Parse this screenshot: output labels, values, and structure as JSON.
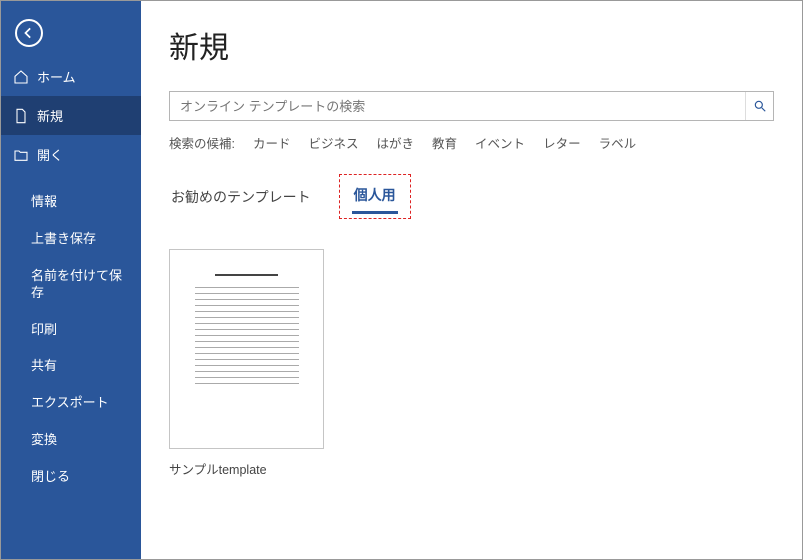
{
  "page": {
    "title": "新規"
  },
  "sidebar": {
    "top": [
      {
        "label": "ホーム",
        "icon": "home"
      },
      {
        "label": "新規",
        "icon": "doc"
      },
      {
        "label": "開く",
        "icon": "folder"
      }
    ],
    "sub": [
      {
        "label": "情報"
      },
      {
        "label": "上書き保存"
      },
      {
        "label": "名前を付けて保存"
      },
      {
        "label": "印刷"
      },
      {
        "label": "共有"
      },
      {
        "label": "エクスポート"
      },
      {
        "label": "変換"
      },
      {
        "label": "閉じる"
      }
    ]
  },
  "search": {
    "placeholder": "オンライン テンプレートの検索"
  },
  "suggest": {
    "label": "検索の候補:",
    "items": [
      "カード",
      "ビジネス",
      "はがき",
      "教育",
      "イベント",
      "レター",
      "ラベル"
    ]
  },
  "tabs": {
    "recommended": "お勧めのテンプレート",
    "personal": "個人用"
  },
  "templates": [
    {
      "label": "サンプルtemplate"
    }
  ]
}
